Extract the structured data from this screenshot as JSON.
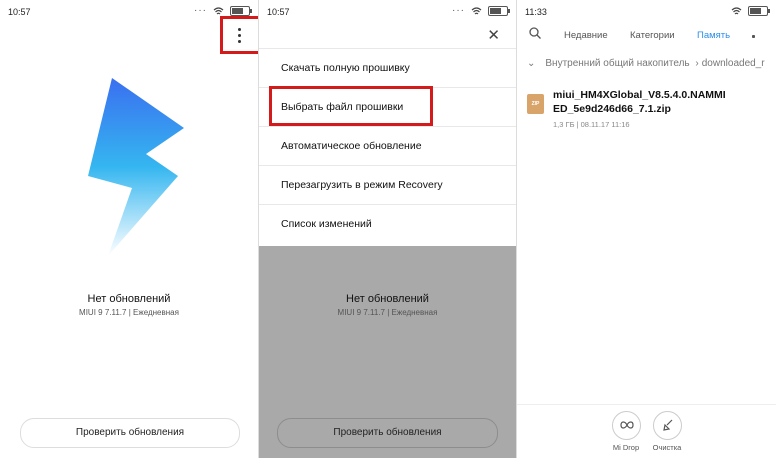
{
  "panel1": {
    "status_time": "10:57",
    "status_title": "Нет обновлений",
    "status_sub": "MIUI 9 7.11.7 | Ежедневная",
    "check_button": "Проверить обновления"
  },
  "panel2": {
    "status_time": "10:57",
    "menu": [
      "Скачать полную прошивку",
      "Выбрать файл прошивки",
      "Автоматическое обновление",
      "Перезагрузить в режим Recovery",
      "Список изменений"
    ],
    "status_title": "Нет обновлений",
    "status_sub": "MIUI 9 7.11.7 | Ежедневная",
    "check_button": "Проверить обновления"
  },
  "panel3": {
    "status_time": "11:33",
    "tabs": [
      "Недавние",
      "Категории",
      "Память"
    ],
    "breadcrumb_root": "Внутренний общий накопитель",
    "breadcrumb_child": "downloaded_r",
    "file_badge": "ZIP",
    "file_name_line1": "miui_HM4XGlobal_V8.5.4.0.NAMMI",
    "file_name_line2": "ED_5e9d246d66_7.1.zip",
    "file_meta": "1,3 ГБ | 08.11.17 11:16",
    "bottom_actions": [
      "Mi Drop",
      "Очистка"
    ]
  },
  "colors": {
    "highlight": "#d41b1b",
    "accent": "#2b8ee8",
    "overlay": "#a9a9a9"
  }
}
